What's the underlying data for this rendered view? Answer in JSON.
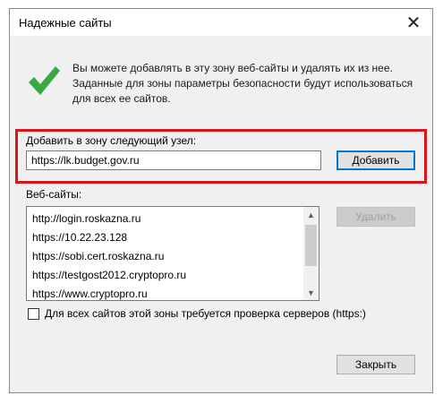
{
  "window": {
    "title": "Надежные сайты"
  },
  "description": "Вы можете добавлять в эту зону  веб-сайты и удалять их из нее. Заданные для зоны параметры безопасности будут использоваться для всех ее сайтов.",
  "add": {
    "label": "Добавить в зону следующий узел:",
    "input_value": "https://lk.budget.gov.ru",
    "button_label": "Добавить"
  },
  "sites": {
    "label": "Веб-сайты:",
    "items": [
      "http://login.roskazna.ru",
      "https://10.22.23.128",
      "https://sobi.cert.roskazna.ru",
      "https://testgost2012.cryptopro.ru",
      "https://www.cryptopro.ru"
    ],
    "remove_button": "Удалить"
  },
  "verify_checkbox": {
    "label": "Для всех сайтов этой зоны требуется проверка серверов (https:)",
    "checked": false
  },
  "close_button": "Закрыть",
  "colors": {
    "highlight": "#d9161a",
    "checkmark": "#3aa845",
    "focus": "#0078d7"
  },
  "icons": {
    "close": "close-icon",
    "checkmark": "checkmark-icon",
    "scroll_up": "chevron-up-icon",
    "scroll_down": "chevron-down-icon"
  }
}
